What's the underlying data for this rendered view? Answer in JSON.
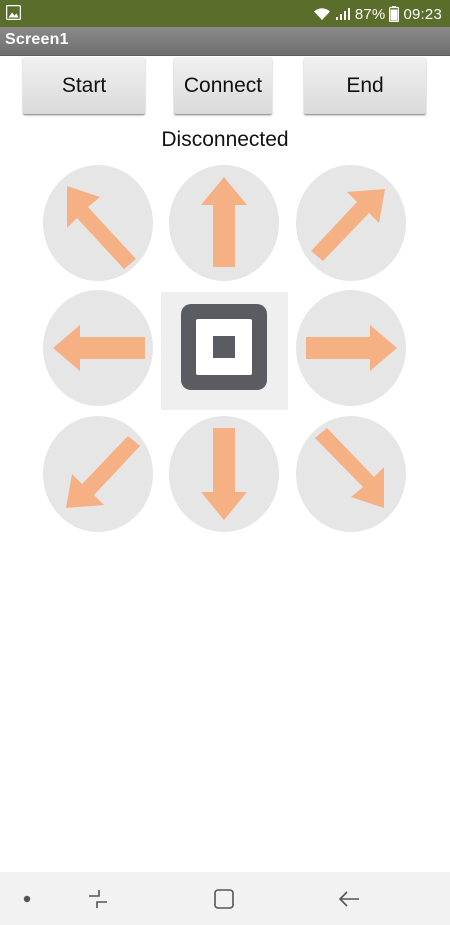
{
  "status_bar": {
    "battery": "87%",
    "time": "09:23"
  },
  "app": {
    "title": "Screen1"
  },
  "toolbar": {
    "start_label": "Start",
    "connect_label": "Connect",
    "end_label": "End"
  },
  "connection_status": "Disconnected",
  "dpad": {
    "buttons": [
      {
        "direction": "up-left",
        "icon": "arrow-up-left-icon"
      },
      {
        "direction": "up",
        "icon": "arrow-up-icon"
      },
      {
        "direction": "up-right",
        "icon": "arrow-up-right-icon"
      },
      {
        "direction": "left",
        "icon": "arrow-left-icon"
      },
      {
        "direction": "stop",
        "icon": "stop-icon"
      },
      {
        "direction": "right",
        "icon": "arrow-right-icon"
      },
      {
        "direction": "down-left",
        "icon": "arrow-down-left-icon"
      },
      {
        "direction": "down",
        "icon": "arrow-down-icon"
      },
      {
        "direction": "down-right",
        "icon": "arrow-down-right-icon"
      }
    ]
  },
  "navigation": {
    "items": [
      "dot-icon",
      "recent-apps-icon",
      "home-icon",
      "back-icon"
    ]
  },
  "colors": {
    "status_bar": "#5b6d2b",
    "title_bar": "#7d7d7d",
    "arrow": "#f5b084",
    "dpad_background": "#e6e6e6",
    "stop_icon": "#5a5c61"
  }
}
